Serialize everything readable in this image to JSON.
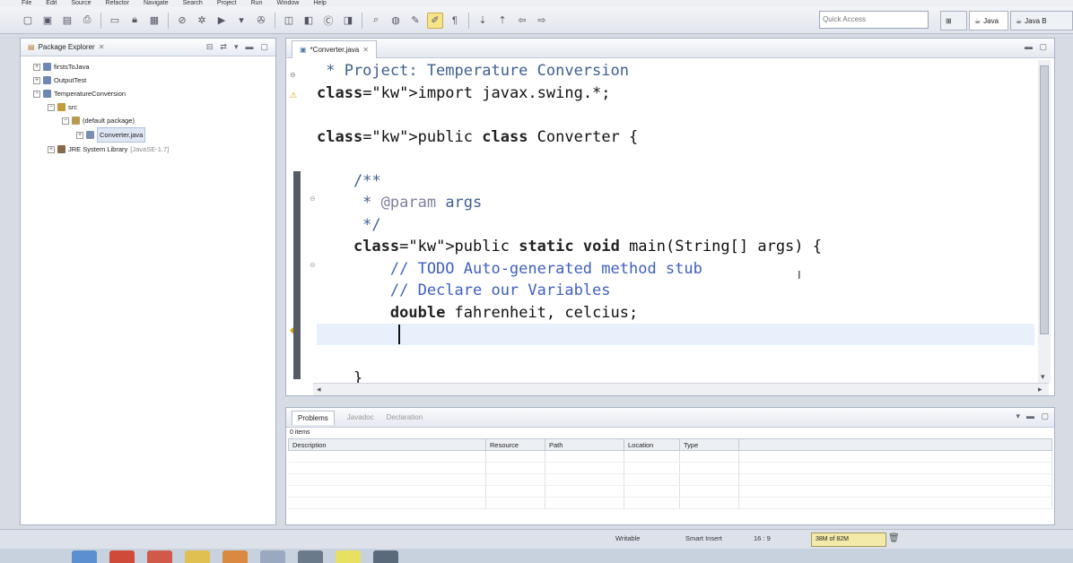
{
  "menubar": {
    "items": [
      "File",
      "Edit",
      "Source",
      "Refactor",
      "Navigate",
      "Search",
      "Project",
      "Run",
      "Window",
      "Help"
    ]
  },
  "toolbar": {
    "quick_access_placeholder": "Quick Access",
    "perspectives": [
      {
        "label": "Java",
        "icon": "java-perspective-icon"
      },
      {
        "label": "Java B",
        "icon": "java-browsing-icon"
      }
    ]
  },
  "package_explorer": {
    "title": "Package Explorer",
    "tree": [
      {
        "label": "firstsToJava",
        "level": 0,
        "expander": "+",
        "icon": "project-icon"
      },
      {
        "label": "OutputTest",
        "level": 0,
        "expander": "+",
        "icon": "project-icon"
      },
      {
        "label": "TemperatureConversion",
        "level": 0,
        "expander": "−",
        "icon": "project-icon"
      },
      {
        "label": "src",
        "level": 1,
        "expander": "−",
        "icon": "source-folder-icon"
      },
      {
        "label": "(default package)",
        "level": 2,
        "expander": "−",
        "icon": "package-icon"
      },
      {
        "label": "Converter.java",
        "level": 3,
        "expander": "+",
        "icon": "java-file-icon",
        "selected": true
      },
      {
        "label": "JRE System Library",
        "suffix": "[JavaSE-1.7]",
        "level": 1,
        "expander": "+",
        "icon": "library-icon"
      }
    ]
  },
  "editor": {
    "tab_label": "*Converter.java",
    "code_lines": [
      " * Project: Temperature Conversion",
      "import javax.swing.*;",
      "",
      "public class Converter {",
      "",
      "    /**",
      "     * @param args",
      "     */",
      "    public static void main(String[] args) {",
      "        // TODO Auto-generated method stub",
      "        // Declare our Variables",
      "        double fahrenheit, celcius;",
      "        ",
      "",
      "    }"
    ]
  },
  "problems": {
    "tabs": [
      {
        "label": "Problems",
        "active": true
      },
      {
        "label": "Javadoc",
        "active": false
      },
      {
        "label": "Declaration",
        "active": false
      }
    ],
    "item_count": "0 items",
    "columns": [
      "Description",
      "Resource",
      "Path",
      "Location",
      "Type"
    ]
  },
  "status": {
    "writable": "Writable",
    "insert_mode": "Smart Insert",
    "position": "16 : 9",
    "heap": "38M of 82M"
  }
}
